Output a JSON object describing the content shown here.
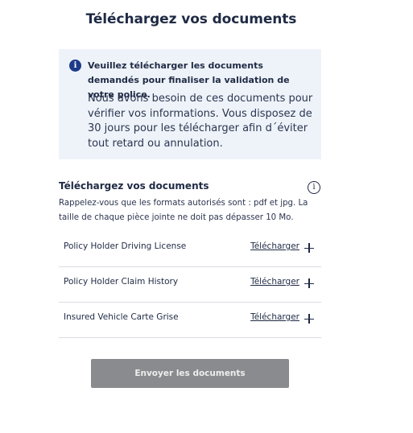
{
  "page": {
    "title": "Téléchargez vos documents"
  },
  "info_box": {
    "icon": "info-icon",
    "icon_glyph": "i",
    "strong_text": "Veuillez télécharger les documents demandés pour finaliser la validation de votre police.",
    "body_text": "Nous avons besoin de ces documents pour vérifier vos informations. Vous disposez de 30 jours pour les télécharger afin d´éviter tout retard ou annulation.",
    "background": "#eef3f9",
    "icon_color": "#1e3a8a"
  },
  "upload_section": {
    "title": "Téléchargez vos documents",
    "help_icon": "info-outline-icon",
    "help_glyph": "i",
    "description": "Rappelez-vous que les formats autorisés sont : pdf et jpg. La taille de chaque pièce jointe ne doit pas dépasser 10 Mo.",
    "documents": [
      {
        "label": "Policy Holder Driving License",
        "action": "Télécharger",
        "icon": "plus-icon"
      },
      {
        "label": "Policy Holder Claim History",
        "action": "Télécharger",
        "icon": "plus-icon"
      },
      {
        "label": "Insured Vehicle Carte Grise",
        "action": "Télécharger",
        "icon": "plus-icon"
      }
    ]
  },
  "submit": {
    "label": "Envoyer les documents",
    "state": "disabled",
    "background": "#8a8b8e"
  },
  "colors": {
    "text_primary": "#1f2a44",
    "divider": "#d9dce3"
  }
}
